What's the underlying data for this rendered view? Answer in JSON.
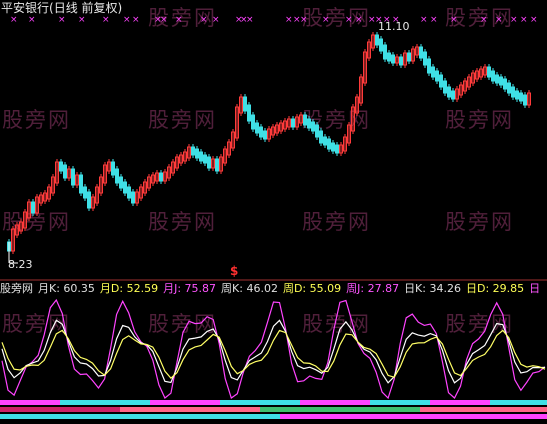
{
  "stock": {
    "name": "平安银行",
    "period": "(日线 前复权)"
  },
  "price_marks": {
    "high": "11.10",
    "low": "8.23",
    "event_marker": "$"
  },
  "indicator_row": [
    {
      "text": "股旁网",
      "color": "#e0e0e0"
    },
    {
      "text": "月K: 60.35",
      "color": "#e0e0e0"
    },
    {
      "text": "月D: 52.59",
      "color": "#ffff55"
    },
    {
      "text": "月J: 75.87",
      "color": "#ff55ff"
    },
    {
      "text": "周K: 46.02",
      "color": "#e0e0e0"
    },
    {
      "text": "周D: 55.09",
      "color": "#ffff55"
    },
    {
      "text": "周J: 27.87",
      "color": "#ff55ff"
    },
    {
      "text": "日K: 34.26",
      "color": "#e0e0e0"
    },
    {
      "text": "日D: 29.85",
      "color": "#ffff55"
    },
    {
      "text": "日",
      "color": "#ff55ff"
    }
  ],
  "watermark": "股旁网",
  "colors": {
    "up": "#ff3b3b",
    "down": "#3fe0e6",
    "kline": "#ffffff",
    "dline": "#ffff66",
    "jline": "#ff44ff",
    "signal": "#cc44cc"
  }
}
